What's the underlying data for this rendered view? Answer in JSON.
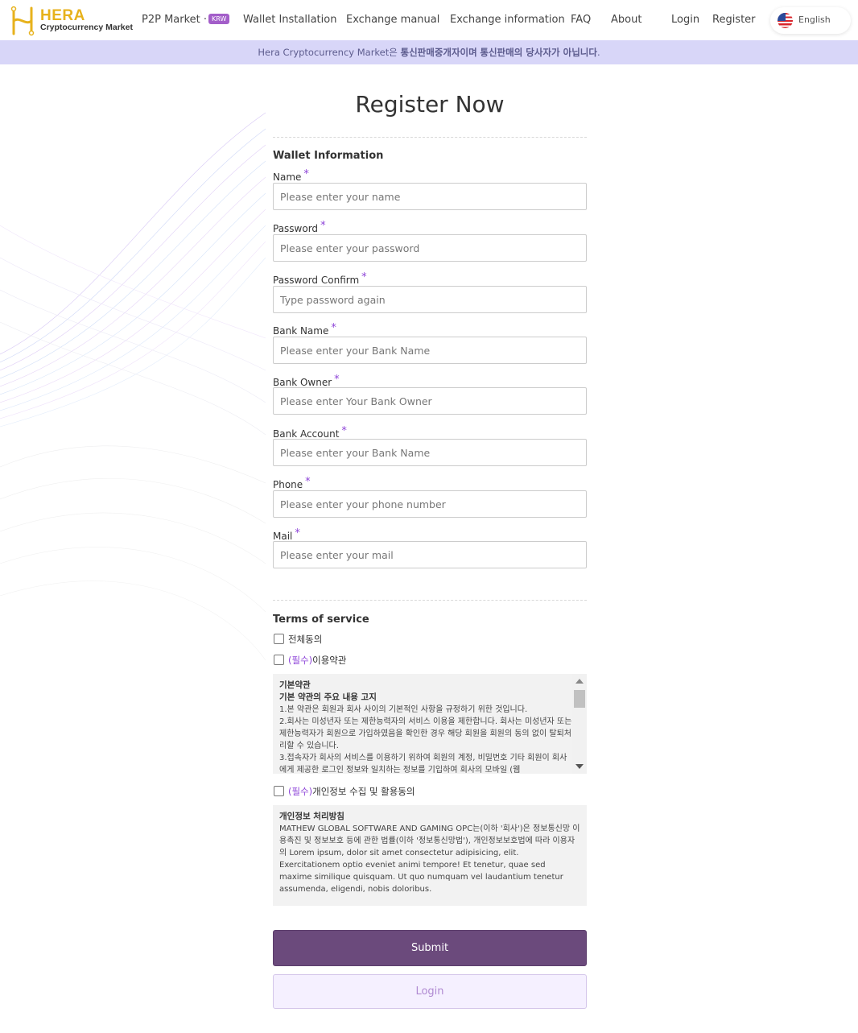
{
  "header": {
    "brand": "HERA",
    "brand_tagline": "Cryptocurrency Market",
    "nav": {
      "p2p_market": "P2P Market ·",
      "p2p_badge": "KRW",
      "wallet_installation": "Wallet Installation",
      "exchange_manual": "Exchange manual",
      "exchange_information": "Exchange information",
      "faq": "FAQ",
      "about": "About",
      "login": "Login",
      "register": "Register"
    },
    "language": "English"
  },
  "notice": {
    "prefix": "Hera Cryptocurrency Market은 ",
    "bold1": "통신판매중개자이며",
    "middle": " ",
    "bold2": "통신판매의 당사자가 아닙니다",
    "suffix": "."
  },
  "form": {
    "title": "Register Now",
    "wallet_section": "Wallet Information",
    "required_mark": "*",
    "fields": {
      "name": {
        "label": "Name",
        "placeholder": "Please enter your name"
      },
      "password": {
        "label": "Password",
        "placeholder": "Please enter your password"
      },
      "password_confirm": {
        "label": "Password Confirm",
        "placeholder": "Type password again"
      },
      "bank_name": {
        "label": "Bank Name",
        "placeholder": "Please enter your Bank Name"
      },
      "bank_owner": {
        "label": "Bank Owner",
        "placeholder": "Please enter Your Bank Owner"
      },
      "bank_account": {
        "label": "Bank Account",
        "placeholder": "Please enter your Bank Name"
      },
      "phone": {
        "label": "Phone",
        "placeholder": "Please enter your phone number"
      },
      "mail": {
        "label": "Mail",
        "placeholder": "Please enter your mail"
      }
    },
    "terms_section": "Terms of service",
    "agree_all": "전체동의",
    "required_tag": "(필수)",
    "terms_of_use": "이용약관",
    "privacy_consent": "개인정보 수집 및 활용동의",
    "terms_text": {
      "heading": "기본약관",
      "subheading": "기본 약관의 주요 내용 고지",
      "items": [
        "1.본 약관은 회원과 회사 사이의 기본적인 사항을 규정하기 위한 것입니다.",
        "2.회사는 미성년자 또는 제한능력자의 서비스 이용을 제한합니다. 회사는 미성년자 또는 제한능력자가 회원으로 가입하였음을 확인한 경우 해당 회원을 회원의 동의 없이 탈퇴처리할 수 있습니다.",
        "3.접속자가 회사의 서비스를 이용하기 위하여 회원의 계정, 비밀번호 기타 회원이 회사에게 제공한 로그인 정보와 일치하는 정보를 기입하여 회사의 모바일 (웹"
      ]
    },
    "privacy_text": {
      "heading": "개인정보 처리방침",
      "body": "MATHEW GLOBAL SOFTWARE AND GAMING OPC는(이하 '회사')은 정보통신망 이용촉진 및 정보보호 등에 관한 법률(이하 '정보통신망법'), 개인정보보호법에 따라 이용자의 Lorem ipsum, dolor sit amet consectetur adipisicing, elit. Exercitationem optio eveniet animi tempore! Et tenetur, quae sed maxime similique quisquam. Ut quo numquam vel laudantium tenetur assumenda, eligendi, nobis doloribus."
    },
    "submit_label": "Submit",
    "login_label": "Login"
  }
}
